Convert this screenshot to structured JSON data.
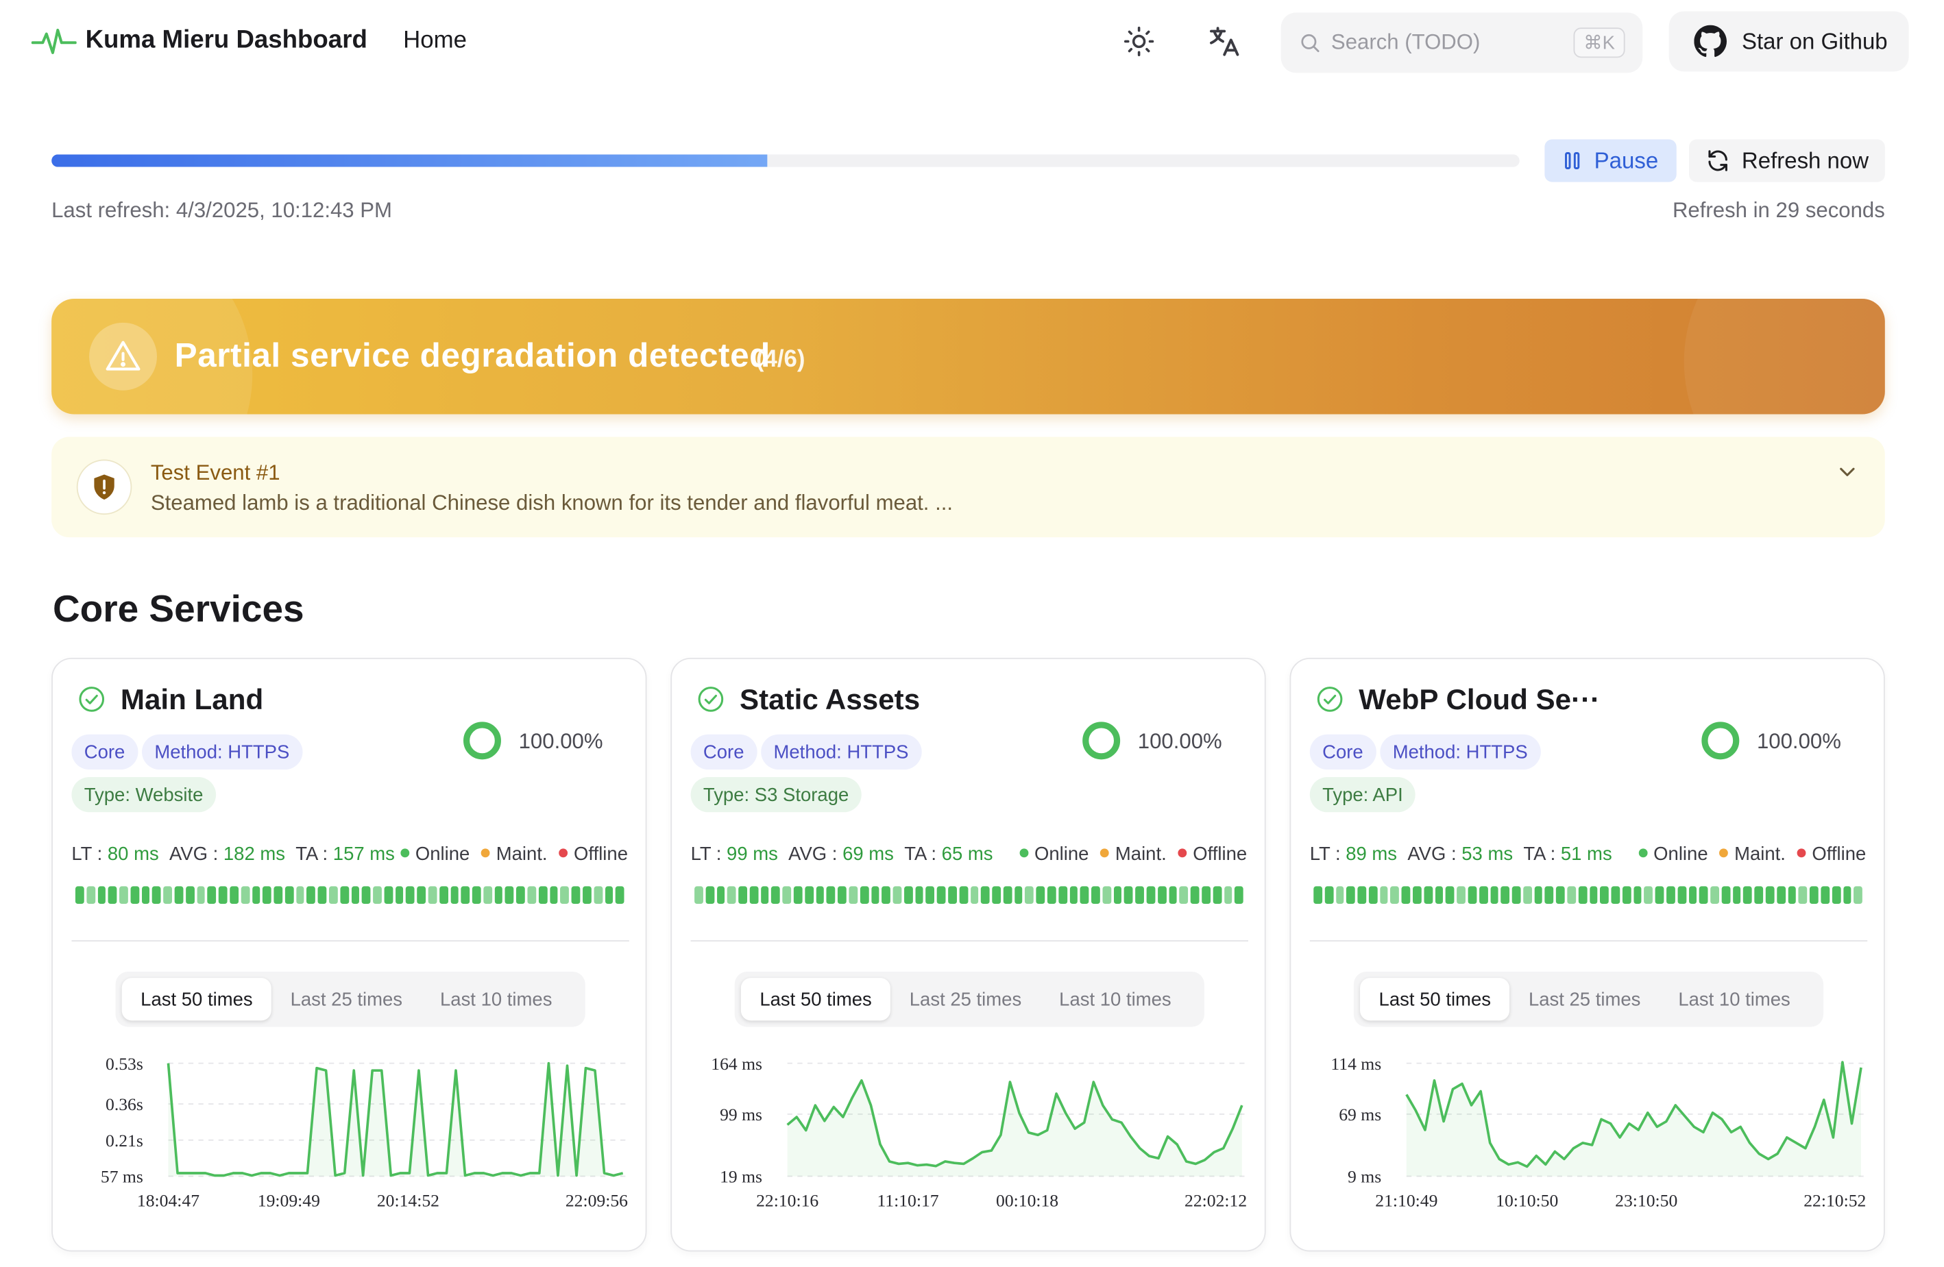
{
  "header": {
    "brand": "Kuma Mieru Dashboard",
    "nav_home": "Home",
    "search_placeholder": "Search (TODO)",
    "search_shortcut": "⌘K",
    "github_label": "Star on Github",
    "icons": [
      "pulse-logo-icon",
      "sun-icon",
      "translate-icon",
      "search-icon",
      "github-icon"
    ]
  },
  "refresh": {
    "progress": 0.488,
    "pause_label": "Pause",
    "refresh_label": "Refresh now",
    "last_refresh": "Last refresh: 4/3/2025, 10:12:43 PM",
    "refresh_in": "Refresh in 29 seconds"
  },
  "banner": {
    "title": "Partial service degradation detected",
    "count": "(4/6)"
  },
  "event": {
    "title": "Test Event #1",
    "description": "Steamed lamb is a traditional Chinese dish known for its tender and flavorful meat. ..."
  },
  "section_title": "Core Services",
  "legend": {
    "online": "Online",
    "maint": "Maint.",
    "offline": "Offline"
  },
  "range_tabs": [
    "Last 50 times",
    "Last 25 times",
    "Last 10 times"
  ],
  "colors": {
    "online": "#4cbd5c",
    "maint": "#f0a73a",
    "offline": "#e5484d",
    "accent": "#2f5fd6"
  },
  "services": [
    {
      "name": "Main Land",
      "tags": [
        "Core",
        "Method: HTTPS",
        "Type: Website"
      ],
      "uptime": "100.00%",
      "lt": "80 ms",
      "avg": "182 ms",
      "ta": "157 ms"
    },
    {
      "name": "Static Assets",
      "tags": [
        "Core",
        "Method: HTTPS",
        "Type: S3 Storage"
      ],
      "uptime": "100.00%",
      "lt": "99 ms",
      "avg": "69 ms",
      "ta": "65 ms"
    },
    {
      "name": "WebP Cloud Se···",
      "tags": [
        "Core",
        "Method: HTTPS",
        "Type: API"
      ],
      "uptime": "100.00%",
      "lt": "89 ms",
      "avg": "53 ms",
      "ta": "51 ms"
    }
  ],
  "chart_data": [
    {
      "type": "area",
      "y_ticks": [
        "0.53s",
        "0.36s",
        "0.21s",
        "57 ms"
      ],
      "x_ticks": [
        "18:04:47",
        "19:09:49",
        "20:14:52",
        "22:09:56"
      ],
      "ylim": [
        0.057,
        0.53
      ],
      "values": [
        0.53,
        0.07,
        0.07,
        0.07,
        0.07,
        0.06,
        0.06,
        0.07,
        0.07,
        0.06,
        0.07,
        0.07,
        0.06,
        0.07,
        0.07,
        0.07,
        0.51,
        0.5,
        0.06,
        0.07,
        0.5,
        0.06,
        0.5,
        0.5,
        0.06,
        0.07,
        0.07,
        0.5,
        0.06,
        0.07,
        0.07,
        0.5,
        0.06,
        0.07,
        0.07,
        0.06,
        0.07,
        0.07,
        0.06,
        0.07,
        0.07,
        0.53,
        0.06,
        0.52,
        0.06,
        0.51,
        0.5,
        0.07,
        0.06,
        0.07
      ]
    },
    {
      "type": "area",
      "y_ticks": [
        "164 ms",
        "99 ms",
        "19 ms"
      ],
      "x_ticks": [
        "22:10:16",
        "11:10:17",
        "00:10:18",
        "22:02:12"
      ],
      "ylim": [
        19,
        164
      ],
      "values": [
        85,
        95,
        78,
        110,
        90,
        108,
        95,
        120,
        142,
        110,
        60,
        38,
        35,
        36,
        33,
        34,
        32,
        38,
        36,
        35,
        42,
        50,
        52,
        72,
        140,
        100,
        75,
        72,
        78,
        125,
        100,
        80,
        88,
        140,
        110,
        92,
        88,
        70,
        55,
        45,
        42,
        70,
        60,
        38,
        35,
        40,
        50,
        55,
        80,
        110
      ]
    },
    {
      "type": "area",
      "y_ticks": [
        "114 ms",
        "69 ms",
        "9 ms"
      ],
      "x_ticks": [
        "21:10:49",
        "10:10:50",
        "23:10:50",
        "22:10:52"
      ],
      "ylim": [
        9,
        114
      ],
      "values": [
        85,
        70,
        52,
        98,
        60,
        90,
        95,
        75,
        88,
        40,
        25,
        20,
        22,
        18,
        28,
        20,
        32,
        25,
        35,
        40,
        38,
        62,
        58,
        45,
        58,
        52,
        68,
        55,
        60,
        75,
        65,
        55,
        50,
        68,
        62,
        50,
        55,
        40,
        30,
        25,
        30,
        45,
        40,
        35,
        55,
        80,
        45,
        115,
        58,
        110
      ]
    }
  ],
  "beats": {
    "pattern_a": [
      1,
      0,
      1,
      1,
      0,
      1,
      1,
      1,
      0,
      1,
      1,
      0,
      1,
      1,
      1,
      0,
      1,
      1,
      1,
      1,
      0,
      1,
      1,
      0,
      1,
      1,
      1,
      0,
      1,
      1,
      1,
      1,
      0,
      1,
      1,
      1,
      1,
      0,
      1,
      1,
      1,
      0,
      1,
      1,
      0,
      1,
      1,
      0,
      1,
      1
    ],
    "pattern_b": [
      0,
      1,
      1,
      0,
      1,
      1,
      1,
      1,
      0,
      1,
      1,
      1,
      1,
      1,
      0,
      1,
      1,
      1,
      0,
      1,
      1,
      1,
      1,
      1,
      1,
      0,
      1,
      1,
      1,
      1,
      0,
      1,
      1,
      1,
      1,
      1,
      1,
      0,
      1,
      1,
      1,
      1,
      1,
      1,
      0,
      1,
      1,
      1,
      0,
      1
    ],
    "pattern_c": [
      1,
      1,
      0,
      1,
      1,
      1,
      0,
      0,
      1,
      1,
      1,
      1,
      1,
      0,
      1,
      1,
      1,
      1,
      1,
      0,
      1,
      1,
      1,
      0,
      1,
      1,
      1,
      1,
      1,
      1,
      0,
      1,
      1,
      1,
      1,
      1,
      0,
      1,
      1,
      1,
      1,
      1,
      1,
      1,
      0,
      1,
      1,
      1,
      1,
      0
    ]
  }
}
